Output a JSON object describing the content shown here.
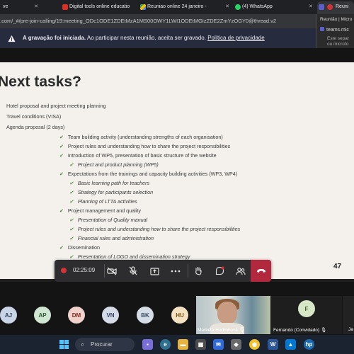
{
  "browser": {
    "tabs": [
      {
        "label": "ve",
        "icon": "tab-partial-icon"
      },
      {
        "label": "Digital tools online educatio",
        "icon": "pdf-icon"
      },
      {
        "label": "Reuniao online 24 janeiro -",
        "icon": "google-drive-icon"
      },
      {
        "label": "(4) WhatsApp",
        "icon": "whatsapp-icon"
      },
      {
        "label": "Reuni",
        "icon": "teams-icon"
      }
    ],
    "url": ".com/_#/pre-join-calling/19:meeting_ODc1ODE1ZDEtMzA1MS00OWY1LWI1ODEtMGIzZDE2ZmYzOGY0@thread.v2"
  },
  "teams_popup": {
    "line1": "Reunião | Micro",
    "line2": "teams.mic",
    "line3": "Este separ",
    "line4": "ou microfo"
  },
  "banner": {
    "bold": "A gravação foi iniciada.",
    "text": " Ao participar nesta reunião, aceita ser gravado. ",
    "link": "Política de privacidade"
  },
  "slide": {
    "title": "Next tasks?",
    "top_items": [
      "Hotel proposal and project meeting planning",
      "Travel conditions (VISA)",
      "Agenda proposal (2 days)"
    ],
    "agenda": [
      {
        "text": "Team building activity (understanding strengths of each organisation)",
        "sub": []
      },
      {
        "text": "Project rules and understanding how to share the project responsibilities",
        "sub": []
      },
      {
        "text": "Introduction of WP5, presentation of basic structure of the website",
        "sub": [
          "Project and product planning (WP5)"
        ]
      },
      {
        "text": "Expectations from the trainings and capacity building activities (WP3, WP4)",
        "sub": [
          "Basic learning path for teachers",
          "Strategy for participants selection",
          "Planning of LTTA activities"
        ]
      },
      {
        "text": "Project management and quality",
        "sub": [
          "Presentation of Quality manual",
          "Project rules and understanding how to share the project responsibilities",
          "Financial rules and administration"
        ]
      },
      {
        "text": "Dissemination",
        "sub": [
          "Presentation of LOGO and dissemination strategy"
        ]
      }
    ],
    "page_number": "47"
  },
  "controls": {
    "timer": "02:25:09",
    "buttons": [
      {
        "name": "camera-off-button",
        "icon": "camera-off-icon",
        "glyph": "⊘"
      },
      {
        "name": "mic-off-button",
        "icon": "mic-off-icon",
        "glyph": "🎙"
      },
      {
        "name": "share-button",
        "icon": "share-icon",
        "glyph": "⇪"
      },
      {
        "name": "more-button",
        "icon": "more-icon",
        "glyph": "•••"
      },
      {
        "name": "raise-hand-button",
        "icon": "hand-icon",
        "glyph": "✋"
      },
      {
        "name": "chat-button",
        "icon": "chat-icon",
        "glyph": "💬"
      },
      {
        "name": "participants-button",
        "icon": "people-icon",
        "glyph": "👥"
      }
    ],
    "hangup_glyph": "☎"
  },
  "participants": [
    {
      "initials": "AJ",
      "bg": "#c9d4e6",
      "fg": "#2a3c5c"
    },
    {
      "initials": "AP",
      "bg": "#cfe6d2",
      "fg": "#2d5a34"
    },
    {
      "initials": "DM",
      "bg": "#f0d1cc",
      "fg": "#7a2e22"
    },
    {
      "initials": "VN",
      "bg": "#d6dbe8",
      "fg": "#36426a"
    },
    {
      "initials": "BK",
      "bg": "#d4dde6",
      "fg": "#34475c"
    },
    {
      "initials": "HU",
      "bg": "#f4e1c2",
      "fg": "#7a5414"
    }
  ],
  "video_participant": {
    "name": "Markéta Hudrnková"
  },
  "fernando": {
    "initials": "F",
    "name": "Fernando (Convidado)",
    "bg": "#d6e6c6",
    "fg": "#3c5c26"
  },
  "last_participant": {
    "name": "Ja"
  },
  "taskbar": {
    "search_label": "Procurar"
  },
  "colors": {
    "banner_bg": "#262b3d",
    "slide_bg": "#f4f1ec",
    "hangup": "#b2283c",
    "check": "#4a8a3a"
  }
}
